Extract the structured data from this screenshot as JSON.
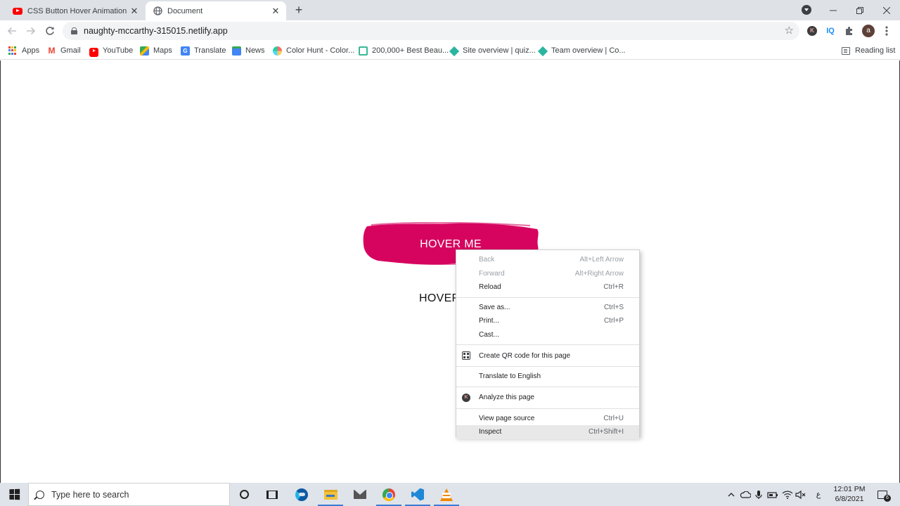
{
  "tabs": [
    {
      "title": "CSS Button Hover Animation Effe",
      "favicon": "youtube-icon",
      "active": false
    },
    {
      "title": "Document",
      "favicon": "globe-icon",
      "active": true
    }
  ],
  "toolbar": {
    "url": "naughty-mccarthy-315015.netlify.app",
    "avatar_letter": "a",
    "ext_k": "K",
    "ext_iq": "IQ"
  },
  "bookmarks": [
    {
      "label": "Apps",
      "icon": "apps-grid-icon"
    },
    {
      "label": "Gmail",
      "icon": "gmail-icon"
    },
    {
      "label": "YouTube",
      "icon": "youtube-icon"
    },
    {
      "label": "Maps",
      "icon": "maps-icon"
    },
    {
      "label": "Translate",
      "icon": "translate-icon"
    },
    {
      "label": "News",
      "icon": "news-icon"
    },
    {
      "label": "Color Hunt - Color...",
      "icon": "colorhunt-icon"
    },
    {
      "label": "200,000+ Best Beau...",
      "icon": "beautiful-icon"
    },
    {
      "label": "Site overview | quiz...",
      "icon": "diamond-icon"
    },
    {
      "label": "Team overview | Co...",
      "icon": "diamond-icon"
    }
  ],
  "reading_list": "Reading list",
  "page": {
    "brush_button": "HOVER ME",
    "plain_button": "HOVER ME"
  },
  "context_menu": {
    "items": [
      {
        "label": "Back",
        "shortcut": "Alt+Left Arrow"
      },
      {
        "label": "Forward",
        "shortcut": "Alt+Right Arrow"
      },
      {
        "label": "Reload",
        "shortcut": "Ctrl+R"
      },
      {
        "label": "Save as...",
        "shortcut": "Ctrl+S"
      },
      {
        "label": "Print...",
        "shortcut": "Ctrl+P"
      },
      {
        "label": "Cast...",
        "shortcut": ""
      },
      {
        "label": "Create QR code for this page",
        "shortcut": ""
      },
      {
        "label": "Translate to English",
        "shortcut": ""
      },
      {
        "label": "Analyze this page",
        "shortcut": ""
      },
      {
        "label": "View page source",
        "shortcut": "Ctrl+U"
      },
      {
        "label": "Inspect",
        "shortcut": "Ctrl+Shift+I"
      }
    ]
  },
  "taskbar": {
    "search_placeholder": "Type here to search",
    "time": "12:01 PM",
    "date": "6/8/2021",
    "notification_count": "6",
    "ime": "ع"
  },
  "colors": {
    "brush": "#d6045f",
    "tabstrip": "#dee1e6",
    "taskbar": "#dfe3ea"
  }
}
